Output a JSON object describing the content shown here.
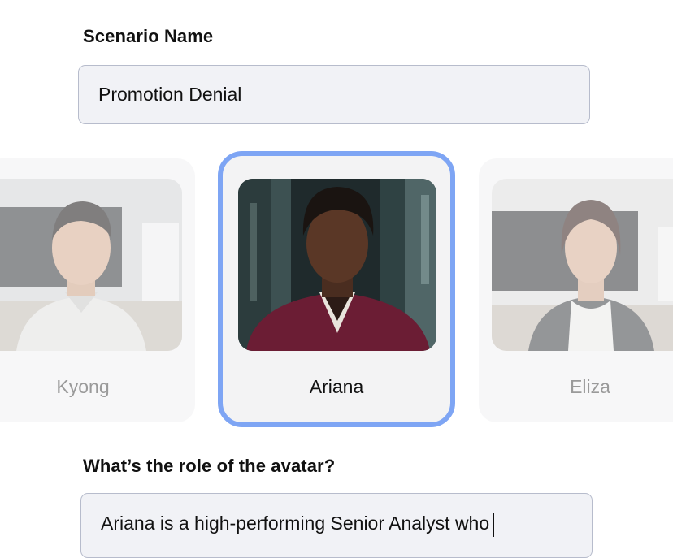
{
  "scenario": {
    "label": "Scenario Name",
    "value": "Promotion Denial"
  },
  "avatars": [
    {
      "name": "Kyong",
      "selected": false
    },
    {
      "name": "Ariana",
      "selected": true
    },
    {
      "name": "Eliza",
      "selected": false
    }
  ],
  "role": {
    "label": "What’s the role of the avatar?",
    "value": "Ariana is a high-performing Senior Analyst who"
  },
  "colors": {
    "selected_border": "#7ea5f4",
    "input_bg": "#f1f2f6",
    "input_border": "#b7bccc",
    "unselected_text": "#9a9a9a"
  }
}
